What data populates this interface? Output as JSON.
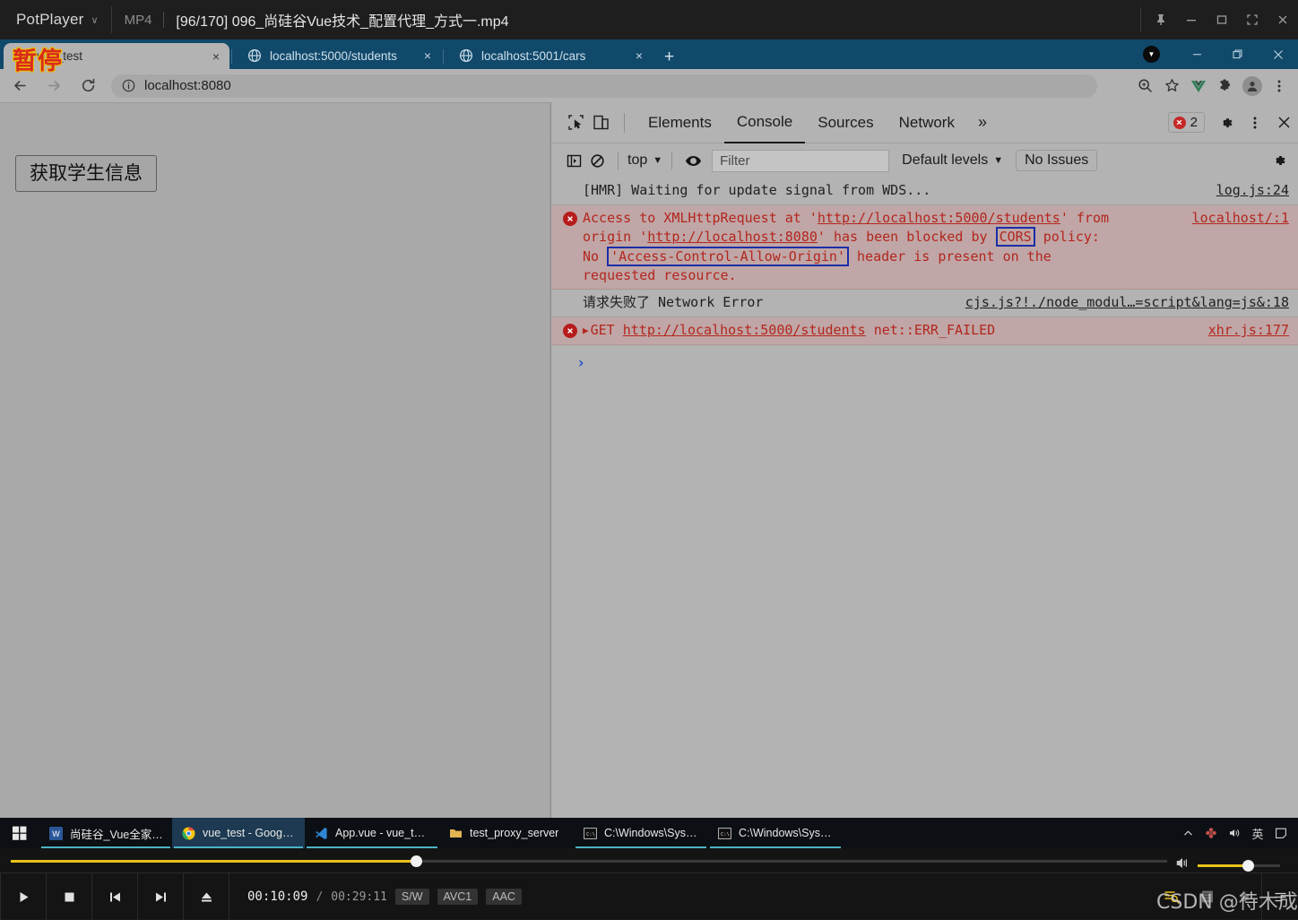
{
  "player": {
    "app_name": "PotPlayer",
    "chevron": "∨",
    "format": "MP4",
    "file_title": "[96/170] 096_尚硅谷Vue技术_配置代理_方式一.mp4",
    "window_buttons": [
      "pin-icon",
      "minimize-icon",
      "maximize-icon",
      "fullscreen-icon",
      "close-icon"
    ],
    "osd_status": "暂停",
    "watermark": "CSDN @待木成植",
    "transport": {
      "play": "play-icon",
      "stop": "stop-icon",
      "previous": "previous-icon",
      "next": "next-icon",
      "eject": "eject-icon"
    },
    "time_current": "00:10:09",
    "time_separator": "/",
    "time_total": "00:29:11",
    "chips": [
      "S/W",
      "AVC1",
      "AAC"
    ],
    "seek_percent": 35,
    "volume_percent": 61,
    "right_buttons": [
      "playlist-search-icon",
      "playlist-icon",
      "settings-icon",
      "list-icon"
    ]
  },
  "browser": {
    "tabs": [
      {
        "title": "vue_test",
        "active": true,
        "favicon": "vue-favicon"
      },
      {
        "title": "localhost:5000/students",
        "active": false,
        "favicon": "globe-favicon"
      },
      {
        "title": "localhost:5001/cars",
        "active": false,
        "favicon": "globe-favicon"
      }
    ],
    "close_glyph": "×",
    "new_tab_glyph": "+",
    "nav": {
      "back": "back-arrow-icon",
      "forward": "forward-arrow-icon",
      "reload": "reload-icon"
    },
    "omnibox": {
      "url": "localhost:8080",
      "info_icon": "info-circle-icon"
    },
    "toolbar_icons": [
      "zoom-icon",
      "bookmark-star-icon",
      "vue-devtools-icon",
      "extensions-puzzle-icon",
      "profile-avatar-icon",
      "chrome-menu-icon"
    ],
    "window_buttons": [
      "minimize-icon",
      "restore-icon",
      "close-icon"
    ]
  },
  "page": {
    "get_students_button": "获取学生信息"
  },
  "devtools": {
    "inspect_icon": "inspect-element-icon",
    "device_icon": "device-toolbar-icon",
    "tabs": [
      {
        "label": "Elements",
        "selected": false
      },
      {
        "label": "Console",
        "selected": true
      },
      {
        "label": "Sources",
        "selected": false
      },
      {
        "label": "Network",
        "selected": false
      }
    ],
    "more_tabs_glyph": "»",
    "error_count": "2",
    "settings_icon": "gear-icon",
    "kebab_icon": "more-options-icon",
    "close_icon": "close-icon",
    "filterbar": {
      "sidebar_icon": "console-sidebar-icon",
      "clear_icon": "clear-console-icon",
      "context": "top",
      "context_caret": "▼",
      "eye_icon": "live-expression-eye-icon",
      "filter_placeholder": "Filter",
      "levels": "Default levels",
      "levels_caret": "▼",
      "issues": "No Issues",
      "settings_icon": "console-settings-gear-icon"
    },
    "messages": [
      {
        "kind": "log",
        "parts": [
          {
            "t": "[HMR] Waiting for update signal from WDS...",
            "s": "plain"
          }
        ],
        "source": "log.js:24",
        "has_error_icon": false
      },
      {
        "kind": "error",
        "parts": [
          {
            "t": "Access to XMLHttpRequest at '",
            "s": "plain"
          },
          {
            "t": "http://localhost:5000/students",
            "s": "underline"
          },
          {
            "t": "' from origin '",
            "s": "plain"
          },
          {
            "t": "http://localhost:8080",
            "s": "underline"
          },
          {
            "t": "' has been blocked by ",
            "s": "plain"
          },
          {
            "t": "CORS",
            "s": "boxed"
          },
          {
            "t": " policy: No ",
            "s": "plain"
          },
          {
            "t": "'Access-Control-Allow-Origin'",
            "s": "boxed"
          },
          {
            "t": " header is present on the requested resource.",
            "s": "plain"
          }
        ],
        "source": "localhost/:1",
        "has_error_icon": true
      },
      {
        "kind": "log",
        "parts": [
          {
            "t": "请求失败了 Network Error",
            "s": "plain"
          }
        ],
        "source": "cjs.js?!./node_modul…=script&lang=js&:18",
        "has_error_icon": false
      },
      {
        "kind": "error",
        "expandable": true,
        "parts": [
          {
            "t": "GET ",
            "s": "plain"
          },
          {
            "t": "http://localhost:5000/students",
            "s": "underline"
          },
          {
            "t": " net::ERR_FAILED",
            "s": "plain"
          }
        ],
        "source": "xhr.js:177",
        "has_error_icon": true
      }
    ],
    "prompt_glyph": "›"
  },
  "taskbar": {
    "start_icon": "windows-start-icon",
    "items": [
      {
        "label": "尚硅谷_Vue全家桶.d...",
        "icon": "word-icon",
        "active": false,
        "running": true
      },
      {
        "label": "vue_test - Google C...",
        "icon": "chrome-icon",
        "active": true,
        "running": true
      },
      {
        "label": "App.vue - vue_test -...",
        "icon": "vscode-icon",
        "active": false,
        "running": true
      },
      {
        "label": "test_proxy_server",
        "icon": "folder-icon",
        "active": false,
        "running": false
      },
      {
        "label": "C:\\Windows\\System...",
        "icon": "cmd-icon",
        "active": false,
        "running": true
      },
      {
        "label": "C:\\Windows\\System...",
        "icon": "cmd-icon",
        "active": false,
        "running": true
      }
    ],
    "tray": [
      "chevron-up-icon",
      "flower-icon",
      "speaker-icon",
      "英",
      "notification-icon"
    ]
  },
  "colors": {
    "tabstrip": "#11496b",
    "chrome_chrome": "#b3b3b3",
    "error_row": "#c0a6a6",
    "error_text": "#b3261e",
    "annotation_box": "#1a2ea8",
    "accent_yellow": "#e8c31a",
    "taskbar": "#0c1014"
  }
}
